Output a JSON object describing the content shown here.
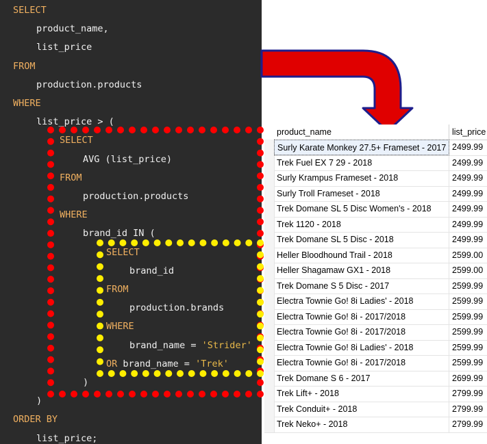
{
  "editor": {
    "lines": [
      {
        "indent": 0,
        "parts": [
          {
            "t": "SELECT",
            "k": "kw"
          }
        ]
      },
      {
        "indent": 1,
        "parts": [
          {
            "t": "product_name,",
            "k": "plain"
          }
        ]
      },
      {
        "indent": 1,
        "parts": [
          {
            "t": "list_price",
            "k": "plain"
          }
        ]
      },
      {
        "indent": 0,
        "parts": [
          {
            "t": "FROM",
            "k": "kw"
          }
        ]
      },
      {
        "indent": 1,
        "parts": [
          {
            "t": "production.products",
            "k": "plain"
          }
        ]
      },
      {
        "indent": 0,
        "parts": [
          {
            "t": "WHERE",
            "k": "kw"
          }
        ]
      },
      {
        "indent": 1,
        "parts": [
          {
            "t": "list_price > (",
            "k": "plain"
          }
        ]
      },
      {
        "indent": 2,
        "parts": [
          {
            "t": "SELECT",
            "k": "kw"
          }
        ]
      },
      {
        "indent": 3,
        "parts": [
          {
            "t": "AVG (list_price)",
            "k": "plain"
          }
        ]
      },
      {
        "indent": 2,
        "parts": [
          {
            "t": "FROM",
            "k": "kw"
          }
        ]
      },
      {
        "indent": 3,
        "parts": [
          {
            "t": "production.products",
            "k": "plain"
          }
        ]
      },
      {
        "indent": 2,
        "parts": [
          {
            "t": "WHERE",
            "k": "kw"
          }
        ]
      },
      {
        "indent": 3,
        "parts": [
          {
            "t": "brand_id IN (",
            "k": "plain"
          }
        ]
      },
      {
        "indent": 4,
        "parts": [
          {
            "t": "SELECT",
            "k": "kw"
          }
        ]
      },
      {
        "indent": 5,
        "parts": [
          {
            "t": "brand_id",
            "k": "plain"
          }
        ]
      },
      {
        "indent": 4,
        "parts": [
          {
            "t": "FROM",
            "k": "kw"
          }
        ]
      },
      {
        "indent": 5,
        "parts": [
          {
            "t": "production.brands",
            "k": "plain"
          }
        ]
      },
      {
        "indent": 4,
        "parts": [
          {
            "t": "WHERE",
            "k": "kw"
          }
        ]
      },
      {
        "indent": 5,
        "parts": [
          {
            "t": "brand_name = ",
            "k": "plain"
          },
          {
            "t": "'Strider'",
            "k": "str"
          }
        ]
      },
      {
        "indent": 4,
        "parts": [
          {
            "t": "OR ",
            "k": "kw"
          },
          {
            "t": "brand_name = ",
            "k": "plain"
          },
          {
            "t": "'Trek'",
            "k": "str"
          }
        ]
      },
      {
        "indent": 3,
        "parts": [
          {
            "t": ")",
            "k": "plain"
          }
        ]
      },
      {
        "indent": 1,
        "parts": [
          {
            "t": ")",
            "k": "plain"
          }
        ]
      },
      {
        "indent": 0,
        "parts": [
          {
            "t": "ORDER BY",
            "k": "kw"
          }
        ]
      },
      {
        "indent": 1,
        "parts": [
          {
            "t": "list_price;",
            "k": "plain"
          }
        ]
      }
    ]
  },
  "colors": {
    "keyword": "#f0b060",
    "outer_dots": "#ff0000",
    "inner_dots": "#ffee00",
    "arrow_fill": "#e00000"
  },
  "results": {
    "columns": [
      "product_name",
      "list_price"
    ],
    "rows": [
      [
        "Surly Karate Monkey 27.5+ Frameset - 2017",
        "2499.99"
      ],
      [
        "Trek Fuel EX 7 29 - 2018",
        "2499.99"
      ],
      [
        "Surly Krampus Frameset - 2018",
        "2499.99"
      ],
      [
        "Surly Troll Frameset - 2018",
        "2499.99"
      ],
      [
        "Trek Domane SL 5 Disc Women's - 2018",
        "2499.99"
      ],
      [
        "Trek 1120 - 2018",
        "2499.99"
      ],
      [
        "Trek Domane SL 5 Disc - 2018",
        "2499.99"
      ],
      [
        "Heller Bloodhound Trail - 2018",
        "2599.00"
      ],
      [
        "Heller Shagamaw GX1 - 2018",
        "2599.00"
      ],
      [
        "Trek Domane S 5 Disc - 2017",
        "2599.99"
      ],
      [
        "Electra Townie Go! 8i Ladies' - 2018",
        "2599.99"
      ],
      [
        "Electra Townie Go! 8i - 2017/2018",
        "2599.99"
      ],
      [
        "Electra Townie Go! 8i - 2017/2018",
        "2599.99"
      ],
      [
        "Electra Townie Go! 8i Ladies' - 2018",
        "2599.99"
      ],
      [
        "Electra Townie Go! 8i - 2017/2018",
        "2599.99"
      ],
      [
        "Trek Domane S 6 - 2017",
        "2699.99"
      ],
      [
        "Trek Lift+ - 2018",
        "2799.99"
      ],
      [
        "Trek Conduit+ - 2018",
        "2799.99"
      ],
      [
        "Trek Neko+ - 2018",
        "2799.99"
      ]
    ]
  }
}
